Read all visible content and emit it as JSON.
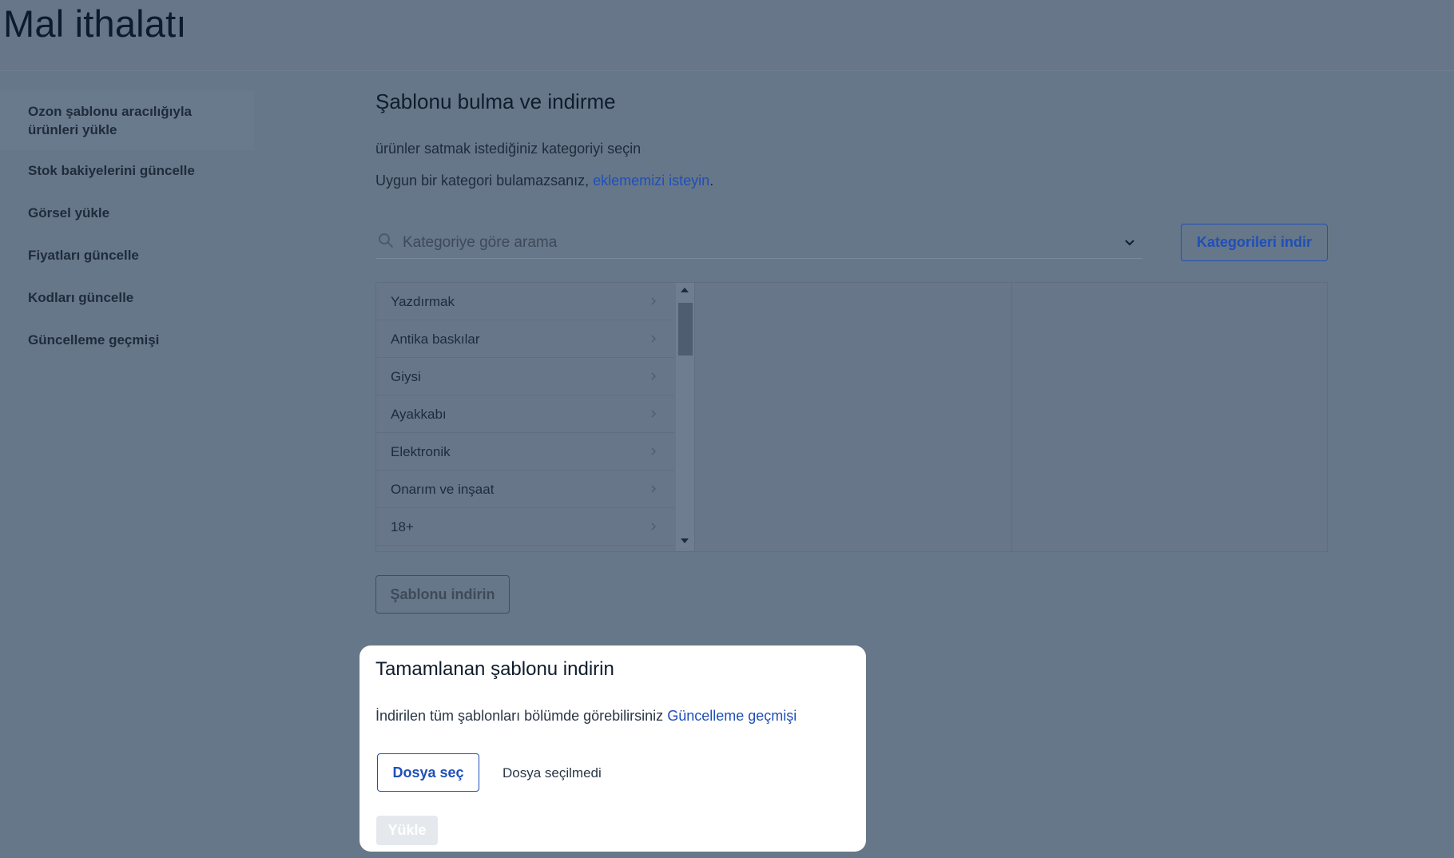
{
  "page": {
    "title": "Mal ithalatı"
  },
  "sidebar": {
    "items": [
      {
        "label": "Ozon şablonu aracılığıyla ürünleri yükle",
        "active": true
      },
      {
        "label": "Stok bakiyelerini güncelle"
      },
      {
        "label": "Görsel yükle"
      },
      {
        "label": "Fiyatları güncelle"
      },
      {
        "label": "Kodları güncelle"
      },
      {
        "label": "Güncelleme geçmişi"
      }
    ]
  },
  "main": {
    "section_title": "Şablonu bulma ve indirme",
    "hint_select": "ürünler satmak istediğiniz kategoriyi seçin",
    "hint_missing_prefix": "Uygun bir kategori bulamazsanız, ",
    "hint_missing_link": "eklememizi isteyin",
    "hint_missing_suffix": ".",
    "search": {
      "placeholder": "Kategoriye göre arama",
      "value": ""
    },
    "categories_button": "Kategorileri indir",
    "categories": [
      "Yazdırmak",
      "Antika baskılar",
      "Giysi",
      "Ayakkabı",
      "Elektronik",
      "Onarım ve inşaat",
      "18+"
    ],
    "download_template_button": "Şablonu indirin"
  },
  "modal": {
    "title": "Tamamlanan şablonu indirin",
    "text_prefix": "İndirilen tüm şablonları bölümde görebilirsiniz ",
    "text_link": "Güncelleme geçmişi",
    "choose_file_button": "Dosya seç",
    "file_status": "Dosya seçilmedi",
    "upload_button": "Yükle"
  },
  "colors": {
    "accent": "#1f4fb8",
    "overlay": "#667789",
    "modal_bg": "#ffffff",
    "disabled": "#e5e8ec"
  },
  "icons": {
    "search": "search-icon",
    "dropdown": "chevron-down-icon",
    "row": "chevron-right-icon"
  }
}
